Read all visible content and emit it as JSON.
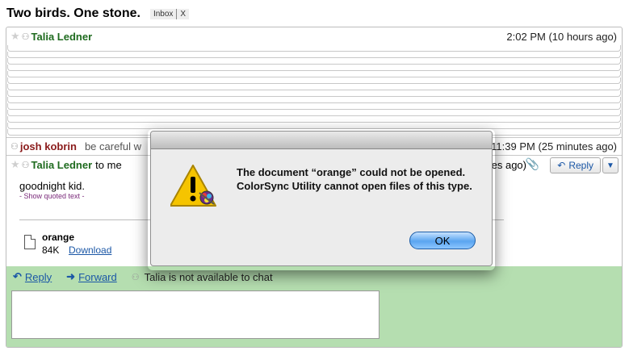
{
  "subject": "Two birds. One stone.",
  "labels": {
    "inbox": "Inbox",
    "remove": "X"
  },
  "messages": [
    {
      "sender": "Talia Ledner",
      "time": "2:02 PM (10 hours ago)"
    },
    {
      "sender": "josh kobrin",
      "snippet": "be careful w",
      "time": "11:39 PM (25 minutes ago)"
    },
    {
      "sender": "Talia Ledner",
      "to": "to me",
      "time_partial": "tes ago)",
      "body": "goodnight kid.",
      "show_quoted": "- Show quoted text -"
    }
  ],
  "attachment": {
    "name": "orange",
    "size": "84K",
    "download": "Download"
  },
  "reply_button": "Reply",
  "reply_zone": {
    "reply": "Reply",
    "forward": "Forward",
    "chat_status": "Talia is not available to chat"
  },
  "dialog": {
    "message": "The document “orange” could not be opened. ColorSync Utility cannot open files of this type.",
    "ok": "OK"
  },
  "icons": {
    "star": "star-icon",
    "presence": "presence-icon",
    "paperclip": "paperclip-icon",
    "reply": "reply-arrow-icon",
    "forward": "forward-arrow-icon",
    "warning": "warning-icon",
    "file": "file-icon"
  }
}
